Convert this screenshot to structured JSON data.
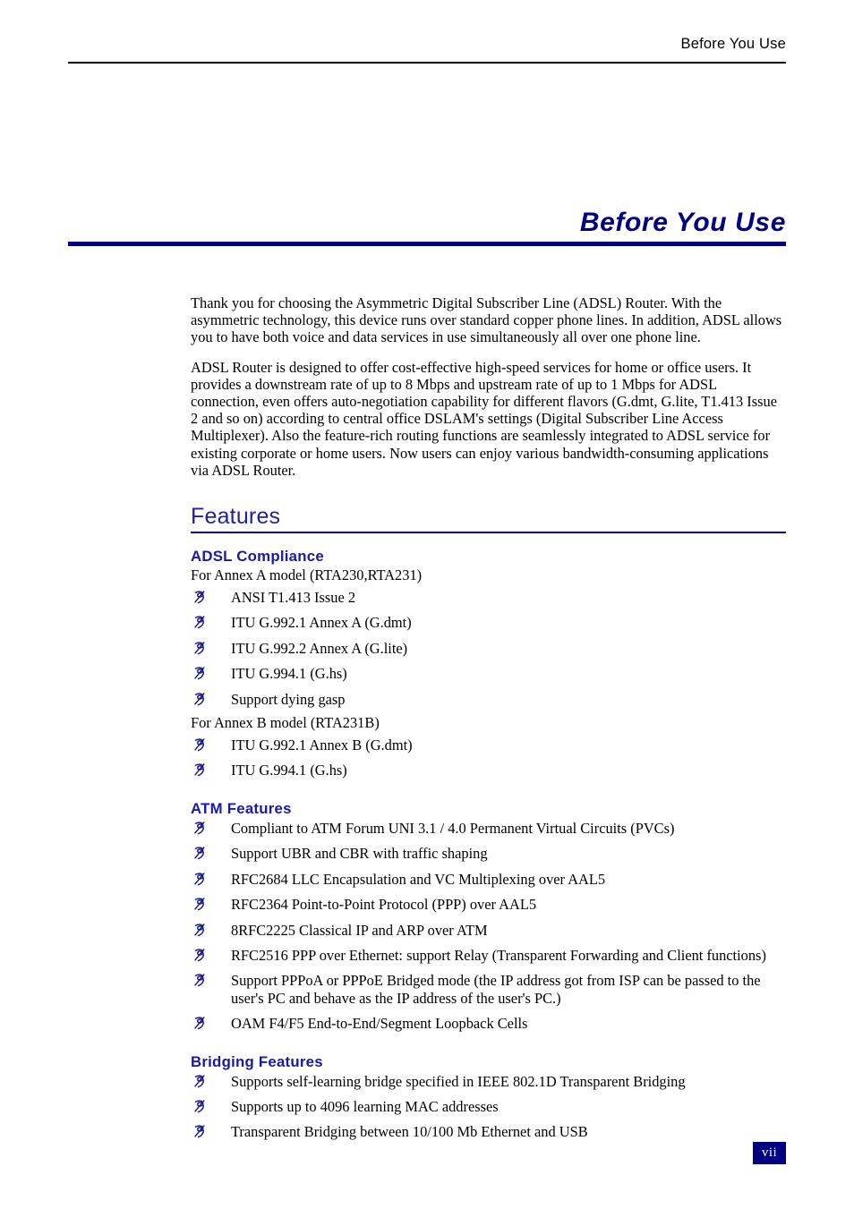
{
  "header": {
    "running_title": "Before You Use"
  },
  "title": {
    "text": "Before You Use"
  },
  "intro": {
    "paragraph_1": "Thank you for choosing the Asymmetric Digital Subscriber Line (ADSL) Router. With the asymmetric technology, this device runs over standard copper phone lines. In addition, ADSL allows you to have both voice and data services in use simultaneously all over one phone line.",
    "paragraph_2": "ADSL Router is designed to offer cost-effective high-speed services for home or office users. It provides a downstream rate of up to 8 Mbps and upstream rate of up to 1 Mbps for ADSL connection, even offers auto-negotiation capability for different flavors (G.dmt, G.lite, T1.413 Issue 2 and so on) according to central office DSLAM's settings (Digital Subscriber Line Access Multiplexer). Also the feature-rich routing functions are seamlessly integrated to ADSL service for existing corporate or home users. Now users can enjoy various bandwidth-consuming applications via ADSL Router."
  },
  "features": {
    "heading": "Features",
    "sections": [
      {
        "heading": "ADSL Compliance",
        "lead_a": "For Annex A model (RTA230,RTA231)",
        "items_a": [
          "ANSI T1.413 Issue 2",
          "ITU G.992.1 Annex A (G.dmt)",
          "ITU G.992.2 Annex A (G.lite)",
          "ITU G.994.1 (G.hs)",
          "Support dying gasp"
        ],
        "lead_b": "For Annex B model (RTA231B)",
        "items_b": [
          "ITU G.992.1 Annex B (G.dmt)",
          "ITU G.994.1 (G.hs)"
        ]
      },
      {
        "heading": "ATM Features",
        "items": [
          "Compliant to ATM Forum UNI 3.1 / 4.0 Permanent Virtual Circuits (PVCs)",
          "Support UBR and CBR with traffic shaping",
          "RFC2684 LLC Encapsulation and VC Multiplexing over AAL5",
          "RFC2364 Point-to-Point Protocol (PPP) over AAL5",
          "8RFC2225 Classical IP and ARP over ATM",
          "RFC2516 PPP over Ethernet: support Relay (Transparent Forwarding and Client functions)",
          "Support PPPoA or PPPoE Bridged mode (the IP address got from ISP can be passed to the user's PC and behave as the IP address of the user's PC.)",
          "OAM F4/F5 End-to-End/Segment Loopback Cells"
        ]
      },
      {
        "heading": "Bridging Features",
        "items": [
          "Supports self-learning bridge specified in IEEE 802.1D Transparent Bridging",
          "Supports up to 4096 learning MAC addresses",
          "Transparent Bridging between 10/100 Mb Ethernet and USB"
        ]
      }
    ]
  },
  "footer": {
    "page_number": "vii"
  },
  "colors": {
    "navy": "#000080",
    "heading_blue": "#1a1aa8",
    "bullet_blue": "#1a1a8c",
    "rule_black": "#000000"
  },
  "icons": {
    "bullet": "wingding-pen-bullet-icon"
  }
}
